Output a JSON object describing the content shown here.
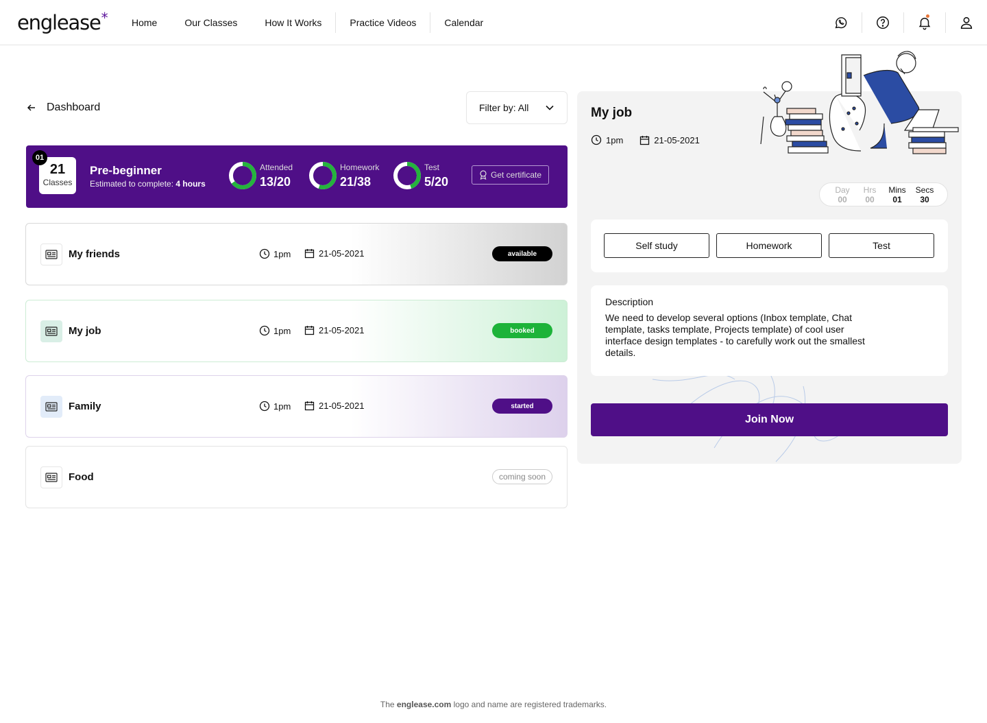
{
  "brand": {
    "logo_text": "englease",
    "logo_mark": "*",
    "accent": "#4f0f87"
  },
  "nav": {
    "items": [
      {
        "label": "Home"
      },
      {
        "label": "Our Classes"
      },
      {
        "label": "How It Works"
      },
      {
        "label": "Practice Videos"
      },
      {
        "label": "Calendar"
      }
    ],
    "icons": [
      "whatsapp-icon",
      "help-icon",
      "bell-icon",
      "user-icon"
    ]
  },
  "page": {
    "back_label": "Dashboard",
    "filter_label": "Filter by: All"
  },
  "course": {
    "number": "01",
    "class_count": "21",
    "class_label": "Classes",
    "name": "Pre-beginner",
    "estimate_prefix": "Estimated to complete:",
    "estimate_value": "4 hours",
    "stats": [
      {
        "label": "Attended",
        "value": "13/20",
        "fraction": 0.65
      },
      {
        "label": "Homework",
        "value": "21/38",
        "fraction": 0.55
      },
      {
        "label": "Test",
        "value": "5/20",
        "fraction": 0.45
      }
    ],
    "certificate_label": "Get certificate"
  },
  "lessons": [
    {
      "name": "My friends",
      "time": "1pm",
      "date": "21-05-2021",
      "status": "available"
    },
    {
      "name": "My job",
      "time": "1pm",
      "date": "21-05-2021",
      "status": "booked"
    },
    {
      "name": "Family",
      "time": "1pm",
      "date": "21-05-2021",
      "status": "started"
    },
    {
      "name": "Food",
      "time": "",
      "date": "",
      "status": "coming soon"
    }
  ],
  "detail": {
    "title": "My job",
    "time": "1pm",
    "date": "21-05-2021",
    "countdown": [
      {
        "label": "Day",
        "value": "00"
      },
      {
        "label": "Hrs",
        "value": "00"
      },
      {
        "label": "Mins",
        "value": "01"
      },
      {
        "label": "Secs",
        "value": "30"
      }
    ],
    "tabs": [
      {
        "label": "Self study"
      },
      {
        "label": "Homework"
      },
      {
        "label": "Test"
      }
    ],
    "description_title": "Description",
    "description": "We need to develop several options (Inbox template, Chat template, tasks template, Projects template) of cool user interface design templates - to carefully work out the smallest details.",
    "join_label": "Join Now"
  },
  "footer": {
    "prefix": "The",
    "site": "englease.com",
    "suffix": "logo and name are registered trademarks."
  }
}
